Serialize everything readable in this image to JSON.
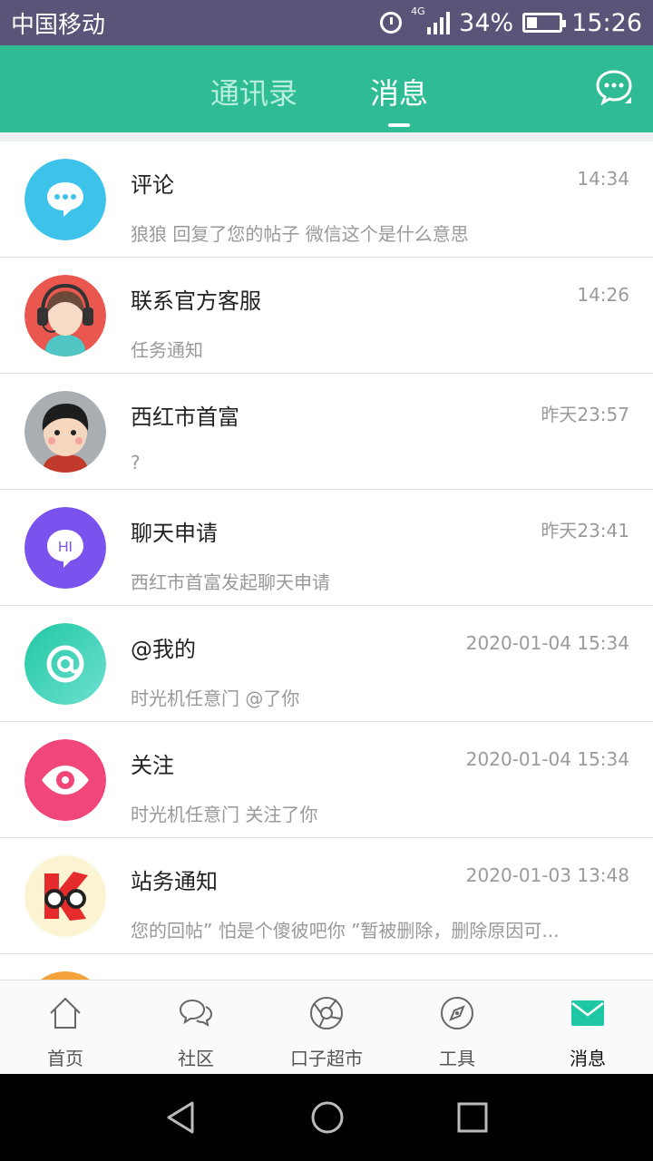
{
  "status_bar": {
    "carrier": "中国移动",
    "network": "4G",
    "battery": "34%",
    "time": "15:26"
  },
  "header": {
    "tabs": [
      "通讯录",
      "消息"
    ],
    "active_tab": "消息"
  },
  "messages": [
    {
      "title": "评论",
      "time": "14:34",
      "preview": "狼狼 回复了您的帖子 微信这个是什么意思",
      "avatar": "comment-avatar",
      "color": "#3dc3ea"
    },
    {
      "title": "联系官方客服",
      "time": "14:26",
      "preview": "任务通知",
      "avatar": "customer-service-avatar",
      "color": "#e9574f"
    },
    {
      "title": "西红市首富",
      "time": "昨天23:57",
      "preview": "?",
      "avatar": "user-avatar",
      "color": "#a9aeb3"
    },
    {
      "title": "聊天申请",
      "time": "昨天23:41",
      "preview": "西红市首富发起聊天申请",
      "avatar": "chat-request-avatar",
      "color": "#7a53ef",
      "badge_text": "HI"
    },
    {
      "title": "@我的",
      "time": "2020-01-04 15:34",
      "preview": "时光机任意门 @了你",
      "avatar": "mention-avatar",
      "color": "#2dc9a8"
    },
    {
      "title": "关注",
      "time": "2020-01-04 15:34",
      "preview": "时光机任意门 关注了你",
      "avatar": "follow-avatar",
      "color": "#f1467a"
    },
    {
      "title": "站务通知",
      "time": "2020-01-03 13:48",
      "preview": "您的回帖” 怕是个傻彼吧你 ”暂被删除，删除原因可...",
      "avatar": "site-notice-avatar",
      "color": "#f5d43a"
    }
  ],
  "bottom_nav": [
    {
      "label": "首页",
      "icon": "home-icon"
    },
    {
      "label": "社区",
      "icon": "community-icon"
    },
    {
      "label": "口子超市",
      "icon": "market-icon"
    },
    {
      "label": "工具",
      "icon": "tools-icon"
    },
    {
      "label": "消息",
      "icon": "mail-icon",
      "active": true
    }
  ],
  "colors": {
    "brand": "#2fbb94",
    "status_bar": "#5a5578"
  }
}
